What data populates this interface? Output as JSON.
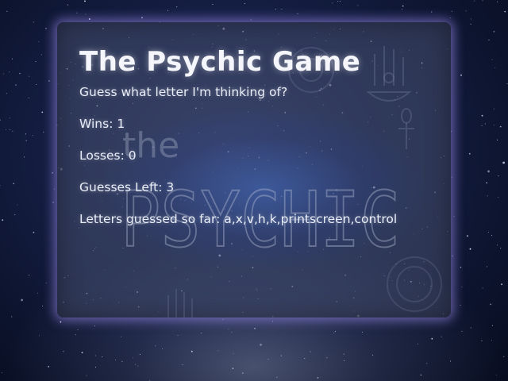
{
  "game": {
    "title": "The Psychic Game",
    "prompt": "Guess what letter I'm thinking of?",
    "wins_label": "Wins: 1",
    "losses_label": "Losses: 0",
    "guesses_left_label": "Guesses Left: 3",
    "letters_guessed_label": "Letters guessed so far: a,x,v,h,k,printscreen,control"
  },
  "background_art": {
    "word_small": "the",
    "word_large": "PSYCHIC"
  },
  "colors": {
    "panel_glow": "#aa96ff",
    "text": "#e9eef8"
  }
}
